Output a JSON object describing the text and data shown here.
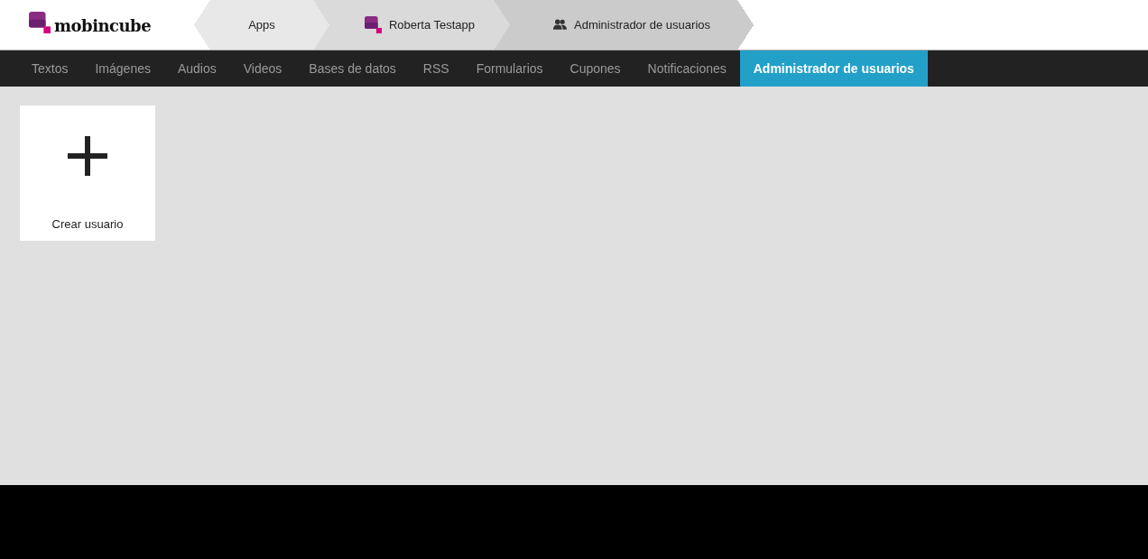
{
  "logo": {
    "text": "mobincube"
  },
  "breadcrumbs": [
    {
      "label": "Apps",
      "kind": "plain"
    },
    {
      "label": "Roberta Testapp",
      "kind": "app"
    },
    {
      "label": "Administrador de usuarios",
      "kind": "users"
    }
  ],
  "tabs": [
    {
      "label": "Textos",
      "selected": false
    },
    {
      "label": "Imágenes",
      "selected": false
    },
    {
      "label": "Audios",
      "selected": false
    },
    {
      "label": "Videos",
      "selected": false
    },
    {
      "label": "Bases de datos",
      "selected": false
    },
    {
      "label": "RSS",
      "selected": false
    },
    {
      "label": "Formularios",
      "selected": false
    },
    {
      "label": "Cupones",
      "selected": false
    },
    {
      "label": "Notificaciones",
      "selected": false
    },
    {
      "label": "Administrador de usuarios",
      "selected": true
    }
  ],
  "create_card": {
    "label": "Crear usuario"
  }
}
